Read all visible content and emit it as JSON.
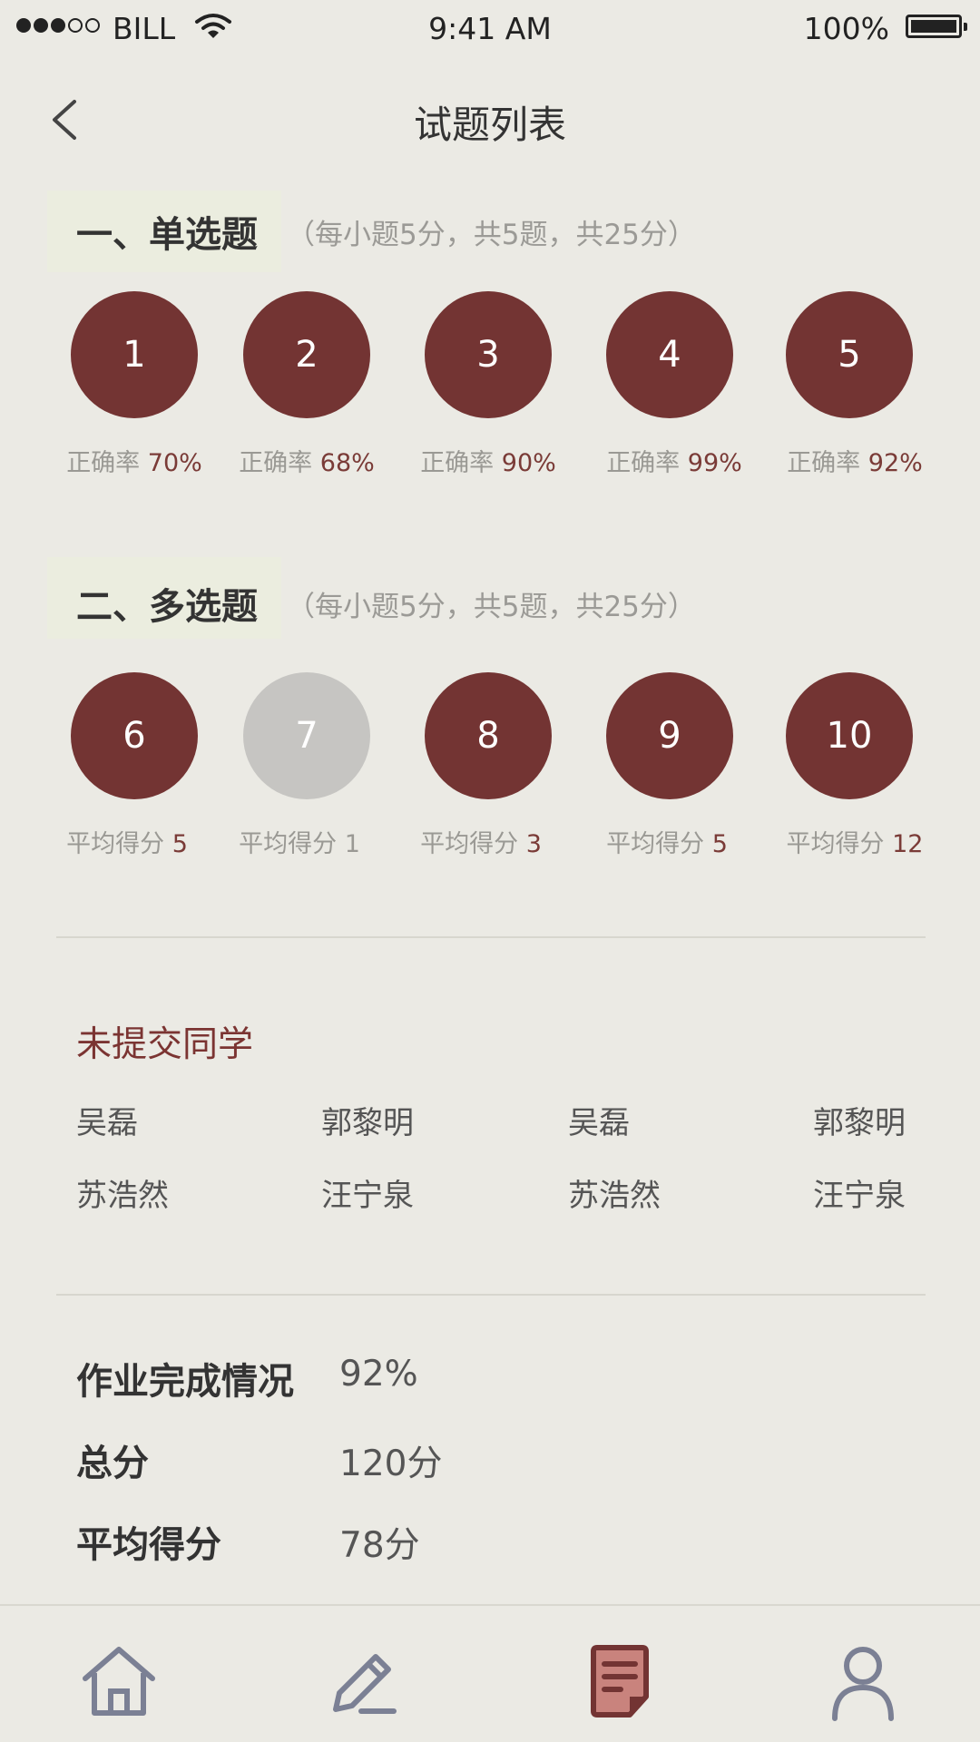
{
  "status_bar": {
    "carrier": "BILL",
    "time": "9:41 AM",
    "battery": "100%"
  },
  "nav": {
    "title": "试题列表"
  },
  "section1": {
    "title": "一、单选题",
    "note": "（每小题5分，共5题，共25分）",
    "stat_label": "正确率",
    "questions": [
      {
        "num": "1",
        "value": "70%"
      },
      {
        "num": "2",
        "value": "68%"
      },
      {
        "num": "3",
        "value": "90%"
      },
      {
        "num": "4",
        "value": "99%"
      },
      {
        "num": "5",
        "value": "92%"
      }
    ]
  },
  "section2": {
    "title": "二、多选题",
    "note": "（每小题5分，共5题，共25分）",
    "stat_label": "平均得分",
    "questions": [
      {
        "num": "6",
        "value": "5"
      },
      {
        "num": "7",
        "value": "1"
      },
      {
        "num": "8",
        "value": "3"
      },
      {
        "num": "9",
        "value": "5"
      },
      {
        "num": "10",
        "value": "12"
      }
    ]
  },
  "missing": {
    "title": "未提交同学",
    "students": [
      "吴磊",
      "郭黎明",
      "吴磊",
      "郭黎明",
      "苏浩然",
      "汪宁泉",
      "苏浩然",
      "汪宁泉"
    ]
  },
  "summary": {
    "completion_label": "作业完成情况",
    "completion_value": "92%",
    "total_label": "总分",
    "total_value": "120分",
    "avg_label": "平均得分",
    "avg_value": "78分"
  },
  "tabs": {
    "icons": [
      "home-icon",
      "pen-icon",
      "document-icon",
      "user-icon"
    ]
  },
  "colors": {
    "accent": "#733433",
    "background": "#ebeae4",
    "disabled": "#c6c5c2",
    "tab_inactive": "#7b8094"
  }
}
